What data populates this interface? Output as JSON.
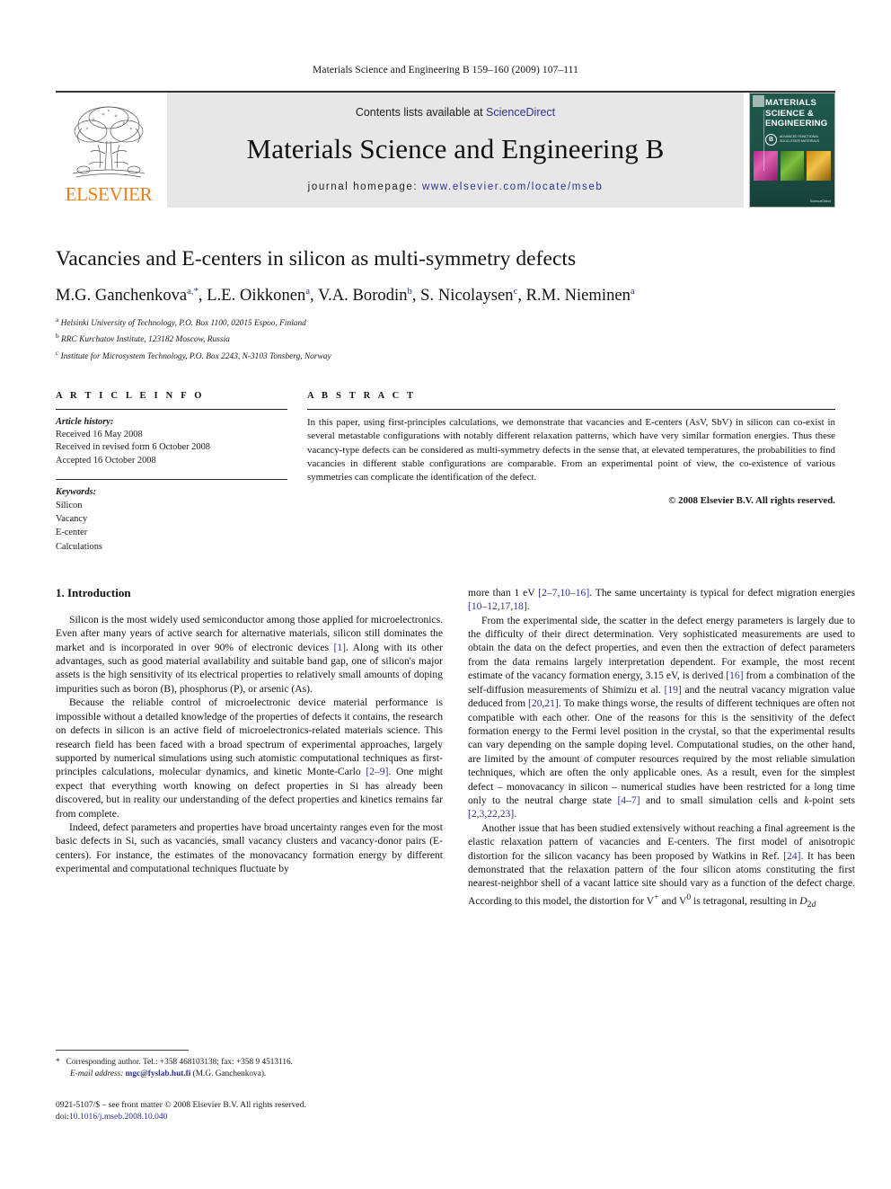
{
  "running_head": "Materials Science and Engineering B 159–160 (2009) 107–111",
  "masthead": {
    "publisher_name": "ELSEVIER",
    "contents_prefix": "Contents lists available at ",
    "contents_link": "ScienceDirect",
    "journal_title": "Materials Science and Engineering B",
    "homepage_label": "journal homepage:",
    "homepage_url": "www.elsevier.com/locate/mseb",
    "cover": {
      "line1": "MATERIALS",
      "line2": "SCIENCE &",
      "line3": "ENGINEERING",
      "series_letter": "B",
      "badge_line1": "ADVANCED FUNCTIONAL",
      "badge_line2": "SOLID-STATE MATERIALS",
      "footer": "ScienceDirect"
    },
    "accent_orange": "#ef7d17",
    "accent_blue": "#2e3191",
    "band_gray": "#e7e7e7",
    "cover_green": "#1d4f45"
  },
  "article": {
    "title": "Vacancies and E-centers in silicon as multi-symmetry defects",
    "authors_html": "M.G. Ganchenkova<sup>a,*</sup>, L.E. Oikkonen<sup>a</sup>, V.A. Borodin<sup>b</sup>, S. Nicolaysen<sup>c</sup>, R.M. Nieminen<sup>a</sup>",
    "affiliations": [
      {
        "marker": "a",
        "text": "Helsinki University of Technology, P.O. Box 1100, 02015 Espoo, Finland"
      },
      {
        "marker": "b",
        "text": "RRC Kurchatov Institute, 123182 Moscow, Russia"
      },
      {
        "marker": "c",
        "text": "Institute for Microsystem Technology, P.O. Box 2243, N-3103 Tonsberg, Norway"
      }
    ]
  },
  "article_info": {
    "heading": "A R T I C L E    I N F O",
    "history_label": "Article history:",
    "history": [
      "Received 16 May 2008",
      "Received in revised form 6 October 2008",
      "Accepted 16 October 2008"
    ],
    "keywords_label": "Keywords:",
    "keywords": [
      "Silicon",
      "Vacancy",
      "E-center",
      "Calculations"
    ]
  },
  "abstract": {
    "heading": "A B S T R A C T",
    "text": "In this paper, using first-principles calculations, we demonstrate that vacancies and E-centers (AsV, SbV) in silicon can co-exist in several metastable configurations with notably different relaxation patterns, which have very similar formation energies. Thus these vacancy-type defects can be considered as multi-symmetry defects in the sense that, at elevated temperatures, the probabilities to find vacancies in different stable configurations are comparable. From an experimental point of view, the co-existence of various symmetries can complicate the identification of the defect.",
    "copyright": "© 2008 Elsevier B.V. All rights reserved."
  },
  "body": {
    "section_number_title": "1.  Introduction",
    "left_paragraphs": [
      "Silicon is the most widely used semiconductor among those applied for microelectronics. Even after many years of active search for alternative materials, silicon still dominates the market and is incorporated in over 90% of electronic devices [1]. Along with its other advantages, such as good material availability and suitable band gap, one of silicon's major assets is the high sensitivity of its electrical properties to relatively small amounts of doping impurities such as boron (B), phosphorus (P), or arsenic (As).",
      "Because the reliable control of microelectronic device material performance is impossible without a detailed knowledge of the properties of defects it contains, the research on defects in silicon is an active field of microelectronics-related materials science. This research field has been faced with a broad spectrum of experimental approaches, largely supported by numerical simulations using such atomistic computational techniques as first-principles calculations, molecular dynamics, and kinetic Monte-Carlo [2–9]. One might expect that everything worth knowing on defect properties in Si has already been discovered, but in reality our understanding of the defect properties and kinetics remains far from complete.",
      "Indeed, defect parameters and properties have broad uncertainty ranges even for the most basic defects in Si, such as vacancies, small vacancy clusters and vacancy-donor pairs (E-centers). For instance, the estimates of the monovacancy formation energy by different experimental and computational techniques fluctuate by"
    ],
    "right_paragraphs": [
      "more than 1 eV [2–7,10–16]. The same uncertainty is typical for defect migration energies [10–12,17,18].",
      "From the experimental side, the scatter in the defect energy parameters is largely due to the difficulty of their direct determination. Very sophisticated measurements are used to obtain the data on the defect properties, and even then the extraction of defect parameters from the data remains largely interpretation dependent. For example, the most recent estimate of the vacancy formation energy, 3.15 eV, is derived [16] from a combination of the self-diffusion measurements of Shimizu et al. [19] and the neutral vacancy migration value deduced from [20,21]. To make things worse, the results of different techniques are often not compatible with each other. One of the reasons for this is the sensitivity of the defect formation energy to the Fermi level position in the crystal, so that the experimental results can vary depending on the sample doping level. Computational studies, on the other hand, are limited by the amount of computer resources required by the most reliable simulation techniques, which are often the only applicable ones. As a result, even for the simplest defect – monovacancy in silicon – numerical studies have been restricted for a long time only to the neutral charge state [4–7] and to small simulation cells and k-point sets [2,3,22,23].",
      "Another issue that has been studied extensively without reaching a final agreement is the elastic relaxation pattern of vacancies and E-centers. The first model of anisotropic distortion for the silicon vacancy has been proposed by Watkins in Ref. [24]. It has been demonstrated that the relaxation pattern of the four silicon atoms constituting the first nearest-neighbor shell of a vacant lattice site should vary as a function of the defect charge. According to this model, the distortion for V+ and V0 is tetragonal, resulting in D2d"
    ]
  },
  "footnotes": {
    "corresponding_marker": "*",
    "corresponding_text": "Corresponding author. Tel.: +358 468103138; fax: +358 9 4513116.",
    "email_label": "E-mail address:",
    "email": "mgc@fyslab.hut.fi",
    "email_owner": "(M.G. Ganchenkova).",
    "imprint_line": "0921-5107/$ – see front matter © 2008 Elsevier B.V. All rights reserved.",
    "doi_label": "doi:",
    "doi": "10.1016/j.mseb.2008.10.040"
  }
}
